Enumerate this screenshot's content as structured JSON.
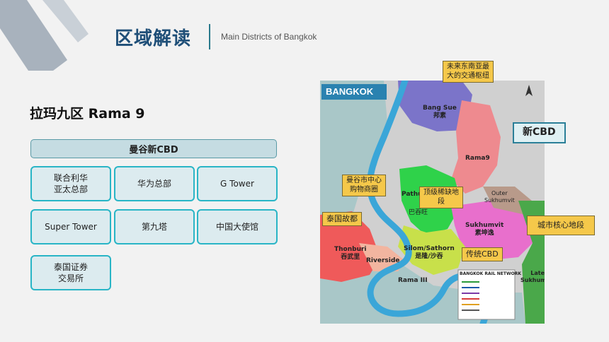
{
  "header": {
    "title": "区域解读",
    "subtitle": "Main Districts of Bangkok"
  },
  "section": {
    "heading": "拉玛九区 Rama 9",
    "cbd_label": "曼谷新CBD",
    "tiles": [
      "联合利华\n亚太总部",
      "华为总部",
      "G Tower",
      "Super Tower",
      "第九塔",
      "中国大使馆",
      "泰国证券\n交易所"
    ]
  },
  "map": {
    "brand": "BANGKOK",
    "district_labels": {
      "bang_sue": "Bang Sue\n邦素",
      "rama9": "Rama9",
      "outer_sukhumvit": "Outer\nSukhumvit",
      "pathum": "Pathum",
      "central": "巴吞旺",
      "sukhumvit": "Sukhumvit\n素坤逸",
      "thonburi": "Thonburi\n吞武里",
      "riverside": "Riverside",
      "silom": "Silom/Sathorn\n是隆/沙吞",
      "rama3": "Rama III",
      "late_sukhumvit": "Late\nSukhumvit",
      "rail_network": "BANGKOK RAIL NETWORK"
    },
    "callouts": {
      "transit_hub": "未来东南亚最\n大的交通枢纽",
      "new_cbd": "新CBD",
      "city_center": "曼谷市中心\n购物商圈",
      "luxury": "顶级稀缺地\n段",
      "old_capital": "泰国故都",
      "core_area": "城市核心地段",
      "traditional_cbd": "传统CBD"
    },
    "colors": {
      "water": "#a9c7c8",
      "river": "#3aa6d8",
      "bang_sue": "#7b74c9",
      "rama9": "#ee8a8f",
      "pathum": "#2fd24a",
      "sukhumvit": "#e86fcc",
      "thonburi": "#ef5a5a",
      "silom": "#c8e04a",
      "late_sukhumvit": "#4aa84a",
      "grey": "#d0d0d0"
    }
  }
}
